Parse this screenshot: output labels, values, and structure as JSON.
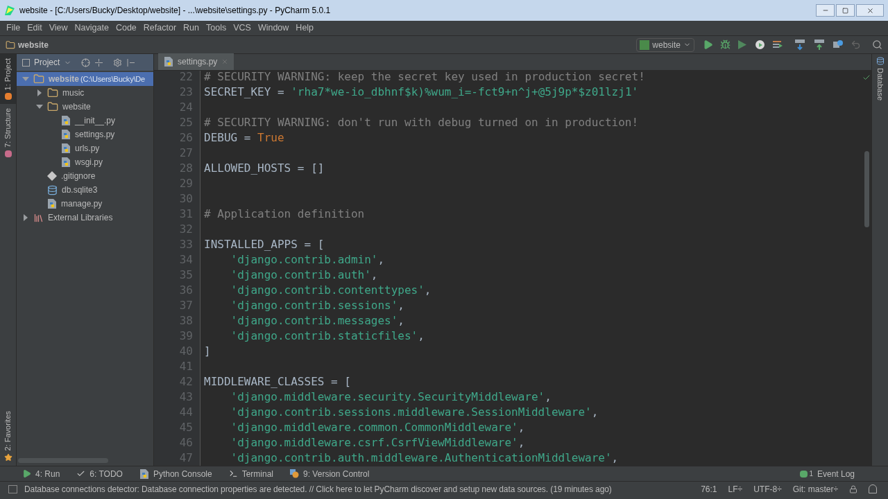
{
  "window": {
    "title": "website - [C:/Users/Bucky/Desktop/website] - ...\\website\\settings.py - PyCharm 5.0.1"
  },
  "menu": [
    "File",
    "Edit",
    "View",
    "Navigate",
    "Code",
    "Refactor",
    "Run",
    "Tools",
    "VCS",
    "Window",
    "Help"
  ],
  "breadcrumb": "website",
  "run_config": "website",
  "left_stripe": [
    {
      "label": "1: Project",
      "selected": true
    },
    {
      "label": "7: Structure",
      "selected": false
    },
    {
      "label": "2: Favorites",
      "selected": false
    }
  ],
  "right_stripe": [
    "Database"
  ],
  "project_panel": {
    "title": "Project",
    "tree": [
      {
        "kind": "folder",
        "label": "website",
        "hint": "(C:\\Users\\Bucky\\De",
        "selected": true,
        "expanded": true,
        "children": [
          {
            "kind": "folder",
            "label": "music",
            "selected": false,
            "expanded": false
          },
          {
            "kind": "folder",
            "label": "website",
            "selected": false,
            "expanded": true,
            "children": [
              {
                "kind": "python",
                "label": "__init__.py",
                "selected": false
              },
              {
                "kind": "python",
                "label": "settings.py",
                "selected": false
              },
              {
                "kind": "python",
                "label": "urls.py",
                "selected": false
              },
              {
                "kind": "python",
                "label": "wsgi.py",
                "selected": false
              }
            ]
          },
          {
            "kind": "git",
            "label": ".gitignore",
            "selected": false
          },
          {
            "kind": "db",
            "label": "db.sqlite3",
            "selected": false
          },
          {
            "kind": "python",
            "label": "manage.py",
            "selected": false
          }
        ]
      },
      {
        "kind": "library",
        "label": "External Libraries",
        "selected": false,
        "expanded": false
      }
    ]
  },
  "editor": {
    "tabs": [
      {
        "label": "settings.py",
        "selected": true
      }
    ],
    "lines": [
      {
        "number": "22",
        "tokens": [
          {
            "kind": "comment",
            "text": "# SECURITY WARNING: keep the secret key used in production secret!"
          }
        ]
      },
      {
        "number": "23",
        "tokens": [
          {
            "kind": "plain",
            "text": "SECRET_KEY = "
          },
          {
            "kind": "string",
            "text": "'rha7*we-io_dbhnf$k)%wum_i=-fct9+n^j+@5j9p*$z01lzj1'"
          }
        ]
      },
      {
        "number": "24"
      },
      {
        "number": "25",
        "tokens": [
          {
            "kind": "comment",
            "text": "# SECURITY WARNING: don't run with debug turned on in production!"
          }
        ]
      },
      {
        "number": "26",
        "tokens": [
          {
            "kind": "plain",
            "text": "DEBUG = "
          },
          {
            "kind": "keyword",
            "text": "True"
          }
        ]
      },
      {
        "number": "27"
      },
      {
        "number": "28",
        "tokens": [
          {
            "kind": "plain",
            "text": "ALLOWED_HOSTS = []"
          }
        ]
      },
      {
        "number": "29"
      },
      {
        "number": "30"
      },
      {
        "number": "31",
        "tokens": [
          {
            "kind": "comment",
            "text": "# Application definition"
          }
        ]
      },
      {
        "number": "32"
      },
      {
        "number": "33",
        "tokens": [
          {
            "kind": "plain",
            "text": "INSTALLED_APPS = ["
          }
        ]
      },
      {
        "number": "34",
        "indented": true,
        "tokens": [
          {
            "kind": "string",
            "text": "'django.contrib.admin'"
          },
          {
            "kind": "plain",
            "text": ","
          }
        ]
      },
      {
        "number": "35",
        "indented": true,
        "tokens": [
          {
            "kind": "string",
            "text": "'django.contrib.auth'"
          },
          {
            "kind": "plain",
            "text": ","
          }
        ]
      },
      {
        "number": "36",
        "indented": true,
        "tokens": [
          {
            "kind": "string",
            "text": "'django.contrib.contenttypes'"
          },
          {
            "kind": "plain",
            "text": ","
          }
        ]
      },
      {
        "number": "37",
        "indented": true,
        "tokens": [
          {
            "kind": "string",
            "text": "'django.contrib.sessions'"
          },
          {
            "kind": "plain",
            "text": ","
          }
        ]
      },
      {
        "number": "38",
        "indented": true,
        "tokens": [
          {
            "kind": "string",
            "text": "'django.contrib.messages'"
          },
          {
            "kind": "plain",
            "text": ","
          }
        ]
      },
      {
        "number": "39",
        "indented": true,
        "tokens": [
          {
            "kind": "string",
            "text": "'django.contrib.staticfiles'"
          },
          {
            "kind": "plain",
            "text": ","
          }
        ]
      },
      {
        "number": "40",
        "tokens": [
          {
            "kind": "plain",
            "text": "]"
          }
        ]
      },
      {
        "number": "41"
      },
      {
        "number": "42",
        "tokens": [
          {
            "kind": "plain",
            "text": "MIDDLEWARE_CLASSES = ["
          }
        ]
      },
      {
        "number": "43",
        "indented": true,
        "tokens": [
          {
            "kind": "string",
            "text": "'django.middleware.security.SecurityMiddleware'"
          },
          {
            "kind": "plain",
            "text": ","
          }
        ]
      },
      {
        "number": "44",
        "indented": true,
        "tokens": [
          {
            "kind": "string",
            "text": "'django.contrib.sessions.middleware.SessionMiddleware'"
          },
          {
            "kind": "plain",
            "text": ","
          }
        ]
      },
      {
        "number": "45",
        "indented": true,
        "tokens": [
          {
            "kind": "string",
            "text": "'django.middleware.common.CommonMiddleware'"
          },
          {
            "kind": "plain",
            "text": ","
          }
        ]
      },
      {
        "number": "46",
        "indented": true,
        "tokens": [
          {
            "kind": "string",
            "text": "'django.middleware.csrf.CsrfViewMiddleware'"
          },
          {
            "kind": "plain",
            "text": ","
          }
        ]
      },
      {
        "number": "47",
        "indented": true,
        "tokens": [
          {
            "kind": "string",
            "text": "'django.contrib.auth.middleware.AuthenticationMiddleware'"
          },
          {
            "kind": "plain",
            "text": ","
          }
        ]
      }
    ]
  },
  "tool_windows": [
    {
      "kind": "run",
      "label": "4: Run"
    },
    {
      "kind": "todo",
      "label": "6: TODO"
    },
    {
      "kind": "console",
      "label": "Python Console"
    },
    {
      "kind": "terminal",
      "label": "Terminal"
    },
    {
      "kind": "vcs",
      "label": "9: Version Control"
    }
  ],
  "event_log": {
    "count": "1",
    "label": "Event Log"
  },
  "status_bar": {
    "message": "Database connections detector: Database connection properties are detected. // Click here to let PyCharm discover and setup new data sources. (19 minutes ago)",
    "items": [
      "76:1",
      "LF÷",
      "UTF-8÷",
      "Git: master÷"
    ]
  }
}
